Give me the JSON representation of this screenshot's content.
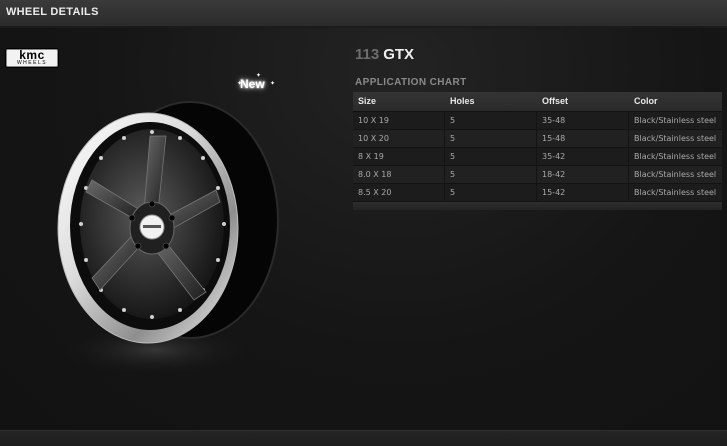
{
  "header": {
    "title": "WHEEL DETAILS"
  },
  "brand": {
    "logo_main": "kmc",
    "logo_sub": "WHEELS"
  },
  "badge": {
    "label": "New"
  },
  "product": {
    "number": "113",
    "name": "GTX"
  },
  "application_chart": {
    "title": "APPLICATION CHART",
    "columns": [
      "Size",
      "Holes",
      "Offset",
      "Color"
    ],
    "rows": [
      [
        "10 X 19",
        "5",
        "35-48",
        "Black/Stainless steel"
      ],
      [
        "10 X 20",
        "5",
        "15-48",
        "Black/Stainless steel"
      ],
      [
        "8 X 19",
        "5",
        "35-42",
        "Black/Stainless steel"
      ],
      [
        "8.0 X 18",
        "5",
        "18-42",
        "Black/Stainless steel"
      ],
      [
        "8.5 X 20",
        "5",
        "15-42",
        "Black/Stainless steel"
      ]
    ]
  },
  "icons": {
    "wheel": "wheel-image",
    "sparkle": "sparkle-icon"
  },
  "colors": {
    "background": "#151515",
    "header": "#333333",
    "text": "#cfcfcf",
    "accent": "#ffffff"
  }
}
